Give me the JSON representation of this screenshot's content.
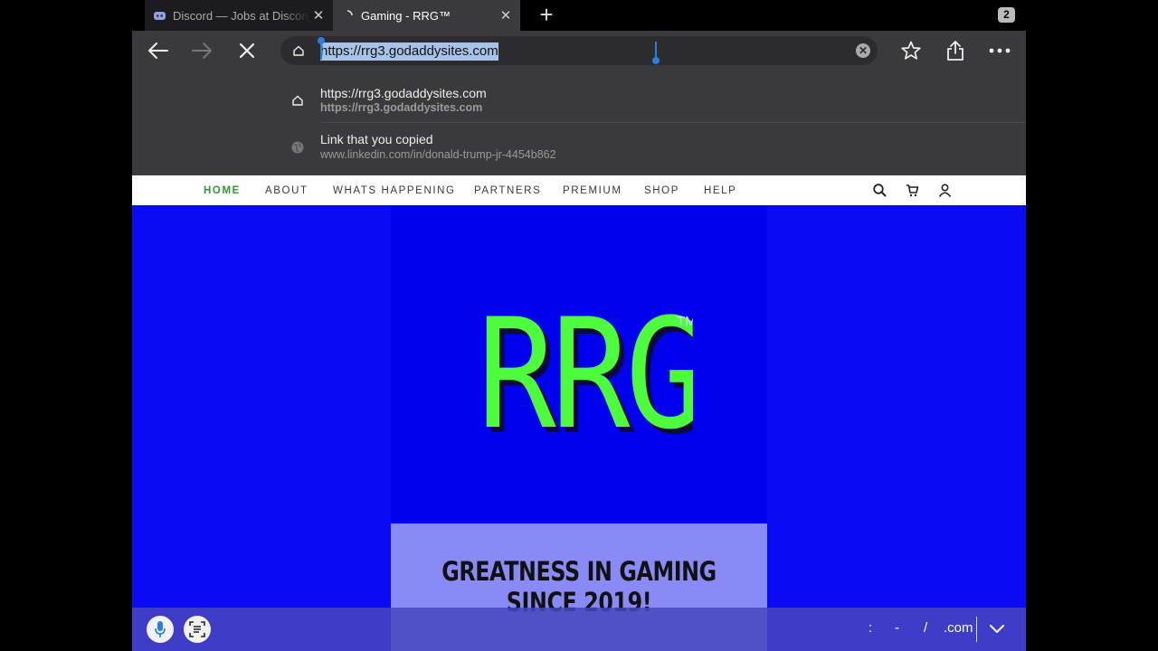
{
  "browser": {
    "tabs": [
      {
        "title": "Discord — Jobs at Discord",
        "favicon": "discord-icon",
        "active": false
      },
      {
        "title": "Gaming - RRG™",
        "favicon": "loading-spinner-icon",
        "active": true
      }
    ],
    "tab_count": "2",
    "toolbar": {
      "back": "back-arrow-icon",
      "forward": "forward-arrow-icon",
      "stop": "close-icon",
      "favorite": "star-icon",
      "share": "share-icon",
      "more": "more-icon"
    },
    "address_bar": {
      "value": "https://rrg3.godaddysites.com"
    },
    "suggestions": [
      {
        "title": "https://rrg3.godaddysites.com",
        "subtitle": "https://rrg3.godaddysites.com",
        "icon": "home-icon"
      },
      {
        "title": "Link that you copied",
        "subtitle": "www.linkedin.com/in/donald-trump-jr-4454b862",
        "icon": "globe-icon"
      }
    ]
  },
  "site": {
    "nav": [
      "HOME",
      "ABOUT",
      "WHATS HAPPENING",
      "PARTNERS",
      "PREMIUM",
      "SHOP",
      "HELP"
    ],
    "logo_text": "RRG",
    "logo_tm": "TM",
    "tagline_line1": "GREATNESS IN GAMING",
    "tagline_line2": "SINCE 2019!",
    "colors": {
      "hero_bg": "#0a0af5",
      "logo_green": "#4dfc3c",
      "nav_active": "#2e9a2e",
      "tag_box": "#8a8af6"
    }
  },
  "keyboard_bar": {
    "keys": [
      ":",
      "-",
      "/",
      ".com"
    ],
    "mic": "microphone-icon",
    "scan": "scan-text-icon",
    "dismiss": "chevron-down-icon"
  }
}
